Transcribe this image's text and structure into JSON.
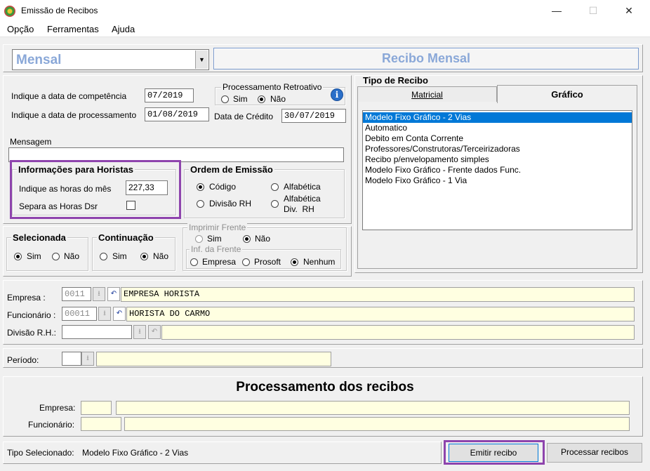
{
  "window": {
    "title": "Emissão de Recibos",
    "minimize": "—",
    "maximize": "☐",
    "close": "✕"
  },
  "menu": [
    "Opção",
    "Ferramentas",
    "Ajuda"
  ],
  "header": {
    "type_value": "Mensal",
    "banner": "Recibo Mensal"
  },
  "dates": {
    "competencia_label": "Indique a data de competência",
    "competencia_value": "07/2019",
    "processamento_label": "Indique a data de processamento",
    "processamento_value": "01/08/2019",
    "credito_label": "Data de Crédito",
    "credito_value": "30/07/2019"
  },
  "retroativo": {
    "title": "Processamento Retroativo",
    "sim": "Sim",
    "nao": "Não",
    "selected": "nao",
    "info_icon": "i"
  },
  "mensagem": {
    "label": "Mensagem",
    "value": ""
  },
  "horistas": {
    "title": "Informações para Horistas",
    "horas_label": "Indique as horas do mês",
    "horas_value": "227,33",
    "dsr_label": "Separa as Horas Dsr"
  },
  "ordem": {
    "title": "Ordem de Emissão",
    "codigo": "Código",
    "alfabetica": "Alfabética",
    "divisao": "Divisão RH",
    "alfa_div_1": "Alfabética",
    "alfa_div_2": "Div.  RH",
    "selected": "codigo"
  },
  "tipo_recibo": {
    "title": "Tipo de Recibo",
    "tab_matricial": "Matricial",
    "tab_grafico": "Gráfico",
    "items": [
      "Modelo Fixo Gráfico - 2 Vias",
      "Automatico",
      "Debito em Conta Corrente",
      "Professores/Construtoras/Terceirizadoras",
      "Recibo p/envelopamento simples",
      "Modelo Fixo Gráfico - Frente dados Func.",
      "Modelo Fixo Gráfico - 1 Via"
    ],
    "selected_index": 0
  },
  "selecionada": {
    "title": "Selecionada",
    "sim": "Sim",
    "nao": "Não",
    "selected": "sim"
  },
  "continuacao": {
    "title": "Continuação",
    "sim": "Sim",
    "nao": "Não",
    "selected": "nao"
  },
  "imprimir_frente": {
    "title": "Imprimir Frente",
    "sim": "Sim",
    "nao": "Não",
    "selected": "nao",
    "inf_title": "Inf. da Frente",
    "empresa": "Empresa",
    "prosoft": "Prosoft",
    "nenhum": "Nenhum",
    "inf_selected": "nenhum"
  },
  "filtros": {
    "empresa_label": "Empresa :",
    "empresa_code": "0011",
    "empresa_name": "EMPRESA HORISTA",
    "funcionario_label": "Funcionário :",
    "funcionario_code": "00011",
    "funcionario_name": "HORISTA DO CARMO",
    "divisao_label": "Divisão R.H.:",
    "divisao_code": "",
    "divisao_name": "",
    "periodo_label": "Período:",
    "periodo_code": "",
    "periodo_name": ""
  },
  "processamento": {
    "title": "Processamento dos recibos",
    "empresa_label": "Empresa:",
    "funcionario_label": "Funcionário:"
  },
  "status": {
    "tipo_label": "Tipo Selecionado:",
    "tipo_value": "Modelo Fixo Gráfico - 2 Vias"
  },
  "buttons": {
    "emitir": "Emitir recibo",
    "processar": "Processar recibos"
  }
}
